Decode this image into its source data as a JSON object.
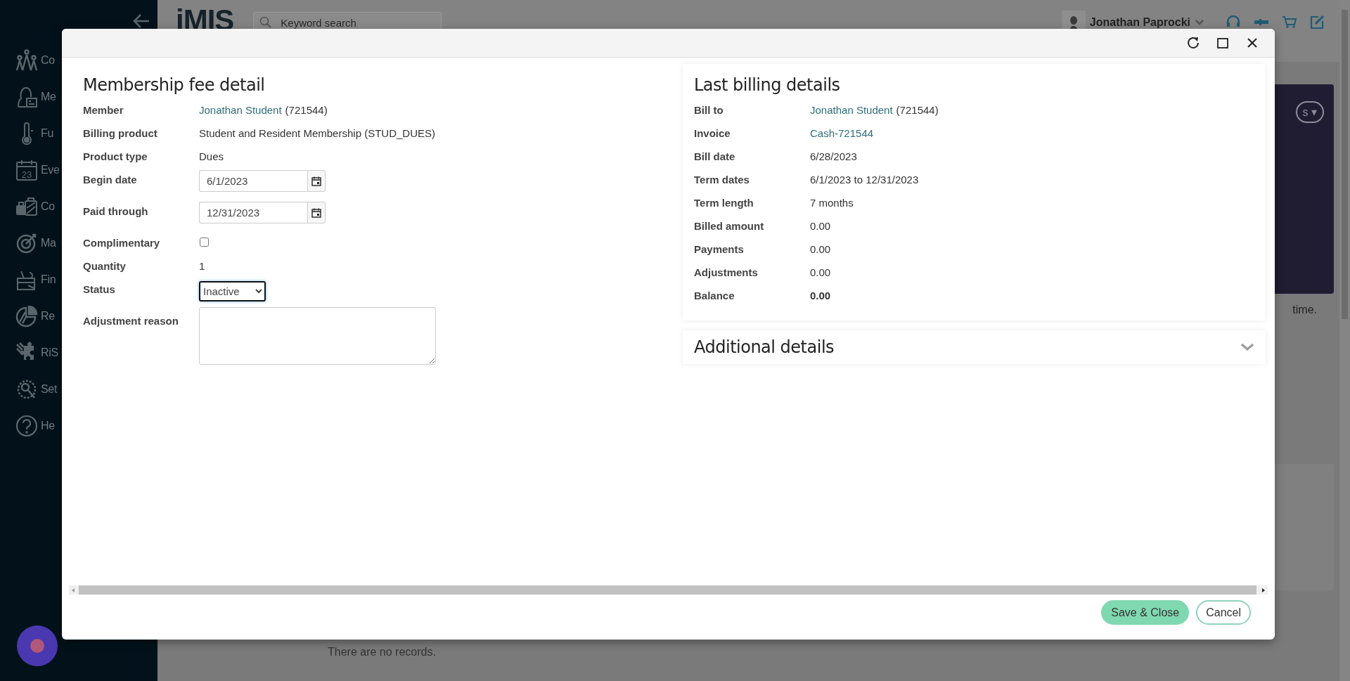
{
  "sidebar": {
    "items": [
      {
        "label": "Co"
      },
      {
        "label": "Me"
      },
      {
        "label": "Fu"
      },
      {
        "icon_text": "23",
        "label": "Eve"
      },
      {
        "label": "Co"
      },
      {
        "label": "Ma"
      },
      {
        "label": "Fin"
      },
      {
        "label": "Re"
      },
      {
        "label": "RiS"
      },
      {
        "label": "Set"
      },
      {
        "label": "He"
      }
    ]
  },
  "header": {
    "logo": "iMIS",
    "search": {
      "placeholder": "Keyword search"
    },
    "user": "Jonathan Paprocki"
  },
  "background": {
    "card_button": "s ▾",
    "note": "time.",
    "empty_message": "There are no records."
  },
  "dialog": {
    "fee_detail": {
      "title": "Membership fee detail",
      "fields": [
        {
          "kind": "link",
          "label": "Member",
          "link": "Jonathan Student",
          "suffix": "(721544)"
        },
        {
          "kind": "text",
          "label": "Billing product",
          "value": "Student and Resident Membership (STUD_DUES)"
        },
        {
          "kind": "text",
          "label": "Product type",
          "value": "Dues"
        },
        {
          "kind": "date",
          "label": "Begin date",
          "value": "6/1/2023"
        },
        {
          "kind": "date",
          "label": "Paid through",
          "value": "12/31/2023"
        },
        {
          "kind": "checkbox",
          "label": "Complimentary",
          "checked": false
        },
        {
          "kind": "text",
          "label": "Quantity",
          "value": "1"
        },
        {
          "kind": "select",
          "label": "Status",
          "value": "Inactive"
        },
        {
          "kind": "textarea",
          "label": "Adjustment reason"
        }
      ]
    },
    "billing": {
      "title": "Last billing details",
      "fields": [
        {
          "kind": "link",
          "label": "Bill to",
          "link": "Jonathan Student",
          "suffix": "(721544)"
        },
        {
          "kind": "link",
          "label": "Invoice",
          "link": "Cash-721544"
        },
        {
          "kind": "text",
          "label": "Bill date",
          "value": "6/28/2023"
        },
        {
          "kind": "text",
          "label": "Term dates",
          "value": "6/1/2023 to 12/31/2023"
        },
        {
          "kind": "text",
          "label": "Term length",
          "value": "7 months"
        },
        {
          "kind": "text",
          "label": "Billed amount",
          "value": "0.00"
        },
        {
          "kind": "text",
          "label": "Payments",
          "value": "0.00"
        },
        {
          "kind": "text",
          "label": "Adjustments",
          "value": "0.00"
        },
        {
          "kind": "bold",
          "label": "Balance",
          "value": "0.00"
        }
      ]
    },
    "additional": {
      "title": "Additional details",
      "expanded": false
    },
    "buttons": [
      {
        "kind": "primary",
        "label": "Save & Close"
      },
      {
        "kind": "secondary",
        "label": "Cancel"
      }
    ]
  }
}
